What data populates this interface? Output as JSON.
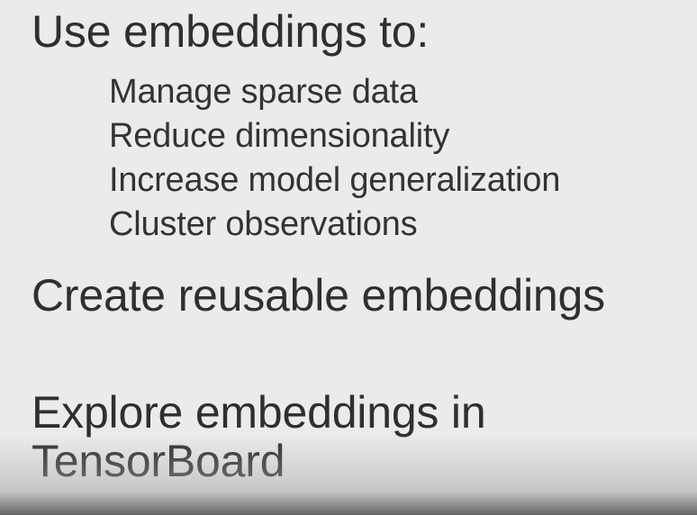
{
  "slide": {
    "heading_1": "Use embeddings to:",
    "bullets": [
      "Manage sparse data",
      "Reduce dimensionality",
      "Increase model generalization",
      "Cluster observations"
    ],
    "heading_2": "Create reusable embeddings",
    "heading_3_line_1": "Explore embeddings in",
    "heading_3_line_2": "TensorBoard"
  }
}
